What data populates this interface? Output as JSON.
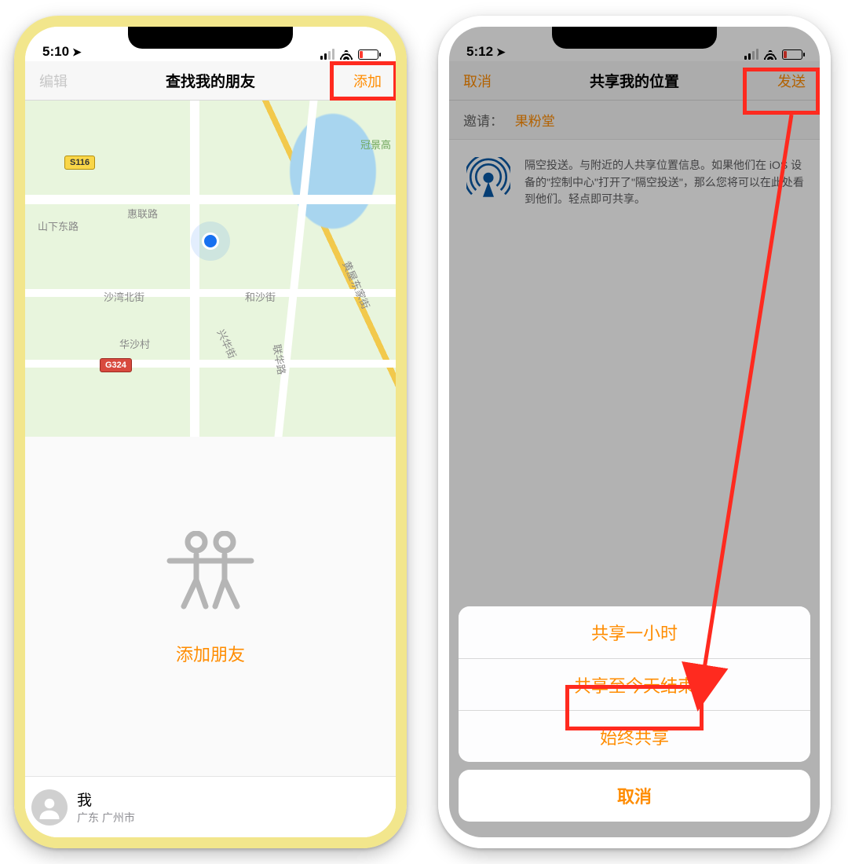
{
  "phone1": {
    "status": {
      "time": "5:10"
    },
    "nav": {
      "left": "编辑",
      "title": "查找我的朋友",
      "right": "添加"
    },
    "map": {
      "shield_s116": "S116",
      "shield_g324": "G324",
      "label_guanjinggao": "冠景高",
      "label_huilian": "惠联路",
      "label_shanxia": "山下东路",
      "label_shawanbeijie": "沙湾北街",
      "label_heshajie": "和沙街",
      "label_huashacun": "华沙村",
      "label_xinghuajie": "兴华街",
      "label_lianhualu": "联华路",
      "label_huangwu": "黄屋东家街"
    },
    "add_friends": "添加朋友",
    "me": {
      "name": "我",
      "location": "广东 广州市"
    }
  },
  "phone2": {
    "status": {
      "time": "5:12"
    },
    "nav": {
      "left": "取消",
      "title": "共享我的位置",
      "right": "发送"
    },
    "invite": {
      "label": "邀请：",
      "name": "果粉堂"
    },
    "airdrop_text": "隔空投送。与附近的人共享位置信息。如果他们在 iOS 设备的\"控制中心\"打开了\"隔空投送\"，那么您将可以在此处看到他们。轻点即可共享。",
    "sheet": {
      "opt1": "共享一小时",
      "opt2": "共享至今天结束",
      "opt3": "始终共享",
      "cancel": "取消"
    }
  }
}
